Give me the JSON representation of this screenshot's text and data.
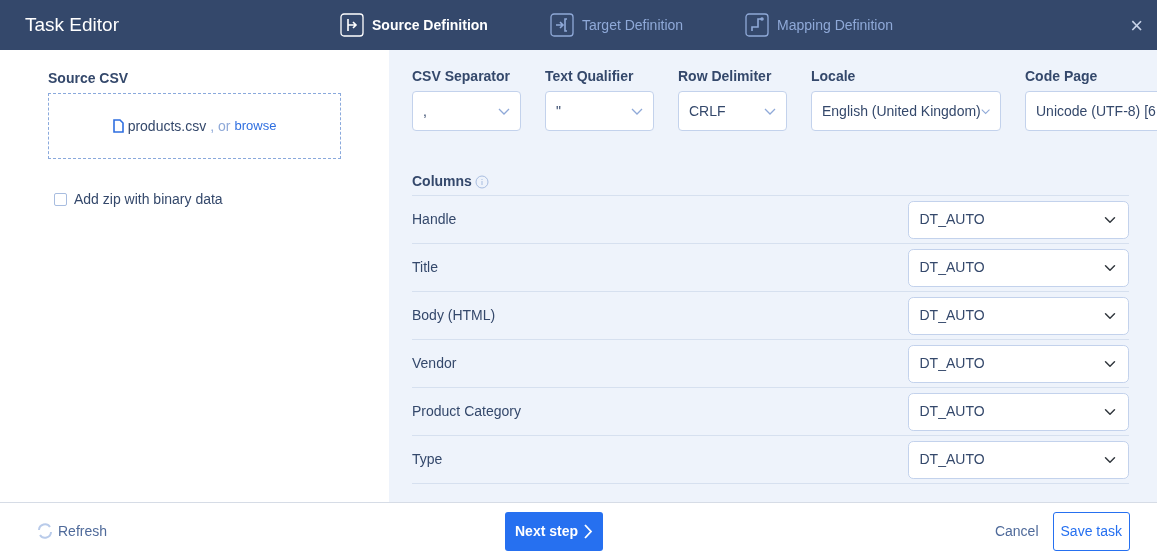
{
  "window": {
    "title": "Task Editor",
    "close": "×"
  },
  "steps": [
    {
      "label": "Source Definition",
      "selected": true,
      "kind": "source"
    },
    {
      "label": "Target Definition",
      "selected": false,
      "kind": "target"
    },
    {
      "label": "Mapping Definition",
      "selected": false,
      "kind": "mapping"
    }
  ],
  "source": {
    "title": "Source CSV",
    "file": "products.csv",
    "or": ", or",
    "browse": "browse",
    "zip": {
      "label": "Add zip with binary data",
      "checked": false
    }
  },
  "options": [
    {
      "label": "CSV Separator",
      "value": ","
    },
    {
      "label": "Text Qualifier",
      "value": "\""
    },
    {
      "label": "Row Delimiter",
      "value": "CRLF"
    },
    {
      "label": "Locale",
      "value": "English (United Kingdom)"
    },
    {
      "label": "Code Page",
      "value": "Unicode (UTF-8) [6"
    }
  ],
  "columns_title": "Columns",
  "columns": [
    {
      "name": "Handle",
      "type": "DT_AUTO"
    },
    {
      "name": "Title",
      "type": "DT_AUTO"
    },
    {
      "name": "Body (HTML)",
      "type": "DT_AUTO"
    },
    {
      "name": "Vendor",
      "type": "DT_AUTO"
    },
    {
      "name": "Product Category",
      "type": "DT_AUTO"
    },
    {
      "name": "Type",
      "type": "DT_AUTO"
    }
  ],
  "footer": {
    "refresh": "Refresh",
    "next": "Next step",
    "cancel": "Cancel",
    "save": "Save task"
  }
}
